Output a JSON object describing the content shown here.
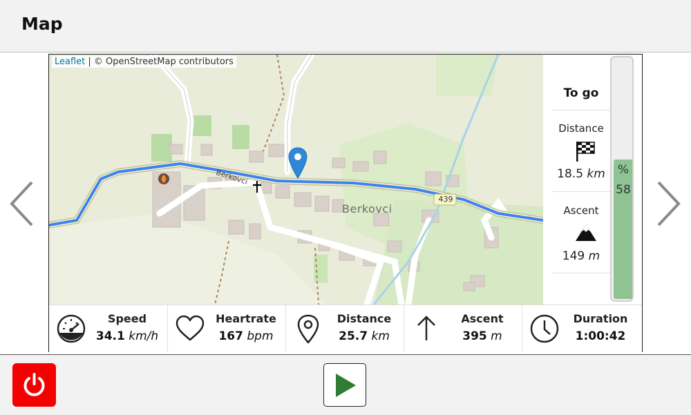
{
  "header": {
    "title": "Map"
  },
  "map": {
    "attribution_link": "Leaflet",
    "attribution_text": " | © OpenStreetMap contributors",
    "place_label": "Berkovci",
    "street_label": "Berkovci",
    "road_number": "439"
  },
  "togo": {
    "heading": "To go",
    "distance_label": "Distance",
    "distance_value": "18.5",
    "distance_unit": "km",
    "ascent_label": "Ascent",
    "ascent_value": "149",
    "ascent_unit": "m"
  },
  "progress": {
    "symbol": "%",
    "value": "58",
    "fraction": 0.58
  },
  "stats": [
    {
      "label": "Speed",
      "value": "34.1",
      "unit": "km/h",
      "icon": "speedometer-icon"
    },
    {
      "label": "Heartrate",
      "value": "167",
      "unit": "bpm",
      "icon": "heart-icon"
    },
    {
      "label": "Distance",
      "value": "25.7",
      "unit": "km",
      "icon": "map-pin-icon"
    },
    {
      "label": "Ascent",
      "value": "395",
      "unit": "m",
      "icon": "arrow-up-icon"
    },
    {
      "label": "Duration",
      "value": "1:00:42",
      "unit": "",
      "icon": "clock-icon"
    }
  ],
  "footer": {
    "power_icon": "power-icon",
    "play_icon": "play-icon"
  },
  "colors": {
    "power": "#f50000",
    "play": "#2e7d32",
    "route": "#3b82f6",
    "progress_fill": "#8fc393"
  }
}
